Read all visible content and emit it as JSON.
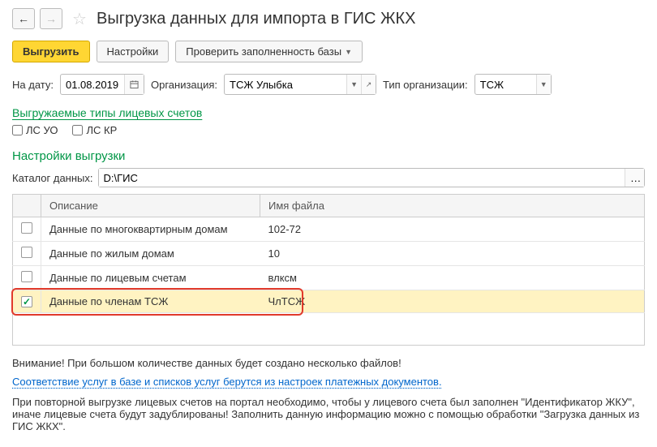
{
  "header": {
    "title": "Выгрузка данных для импорта в ГИС ЖКХ"
  },
  "toolbar": {
    "export_label": "Выгрузить",
    "settings_label": "Настройки",
    "check_label": "Проверить заполненность базы"
  },
  "filters": {
    "date_label": "На дату:",
    "date_value": "01.08.2019",
    "org_label": "Организация:",
    "org_value": "ТСЖ Улыбка",
    "org_type_label": "Тип организации:",
    "org_type_value": "ТСЖ"
  },
  "account_types": {
    "link_label": "Выгружаемые типы лицевых счетов",
    "cb1_label": "ЛС УО",
    "cb2_label": "ЛС КР"
  },
  "export_settings": {
    "title": "Настройки выгрузки",
    "catalog_label": "Каталог данных:",
    "catalog_value": "D:\\ГИС"
  },
  "table": {
    "col_cb": "",
    "col_desc": "Описание",
    "col_file": "Имя файла",
    "rows": [
      {
        "checked": false,
        "desc": "Данные по многоквартирным домам",
        "file": "102-72"
      },
      {
        "checked": false,
        "desc": "Данные по жилым домам",
        "file": "10"
      },
      {
        "checked": false,
        "desc": "Данные по лицевым счетам",
        "file": "влксм"
      },
      {
        "checked": true,
        "desc": "Данные по членам ТСЖ",
        "file": "ЧлТСЖ"
      }
    ]
  },
  "footer": {
    "warn1": "Внимание! При большом количестве данных будет создано несколько файлов!",
    "link": "Соответствие услуг в базе и списков услуг берутся из настроек платежных документов.",
    "warn2": "При повторной выгрузке лицевых счетов на портал необходимо, чтобы у лицевого счета был заполнен \"Идентификатор ЖКУ\", иначе лицевые счета будут задублированы! Заполнить данную информацию можно с помощью обработки \"Загрузка данных из ГИС ЖКХ\"."
  }
}
